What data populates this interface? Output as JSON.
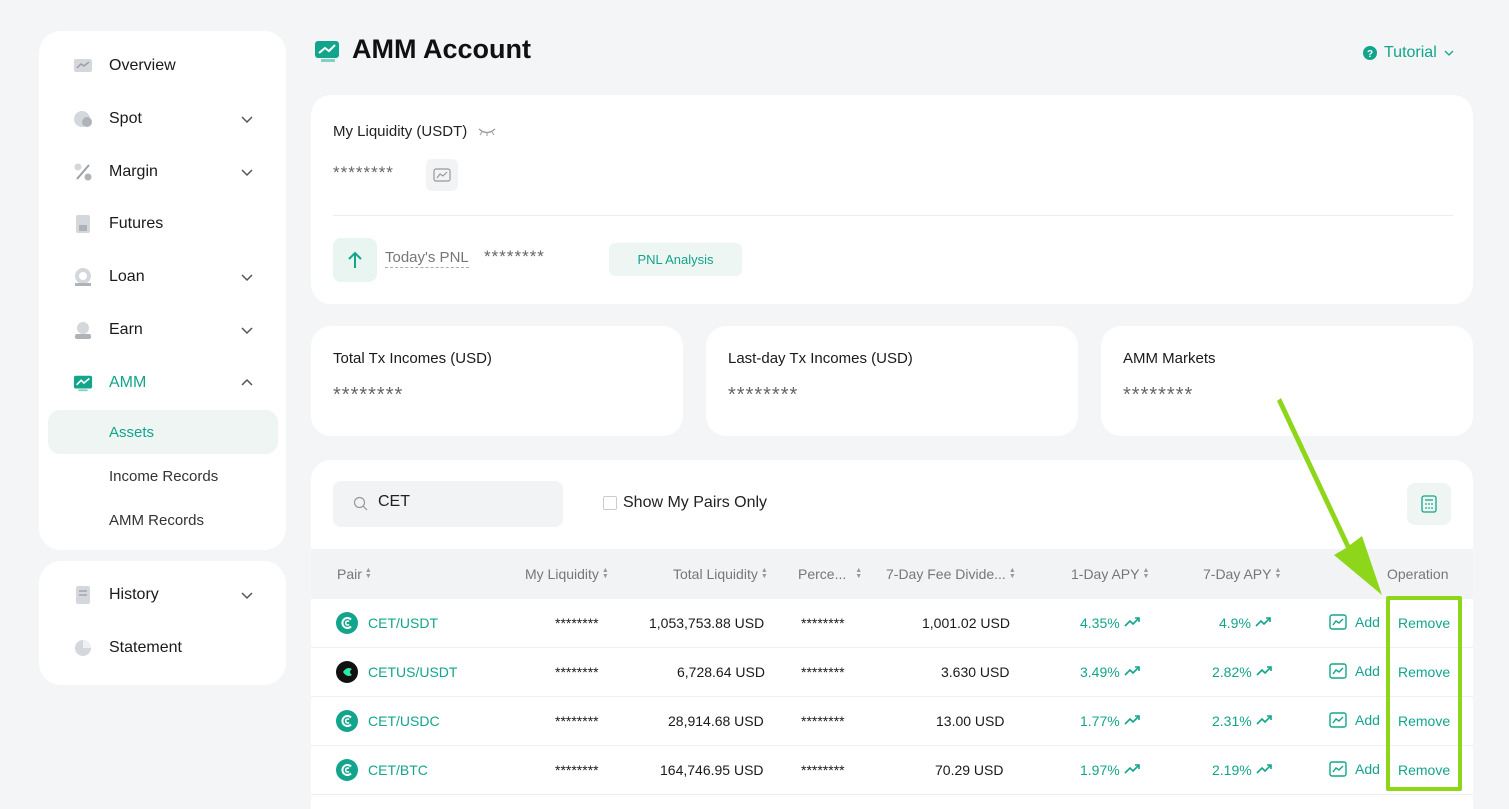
{
  "sidebar": {
    "items": [
      {
        "label": "Overview",
        "icon": "overview-icon"
      },
      {
        "label": "Spot",
        "icon": "spot-icon"
      },
      {
        "label": "Margin",
        "icon": "margin-icon"
      },
      {
        "label": "Futures",
        "icon": "futures-icon"
      },
      {
        "label": "Loan",
        "icon": "loan-icon"
      },
      {
        "label": "Earn",
        "icon": "earn-icon"
      },
      {
        "label": "AMM",
        "icon": "amm-icon"
      }
    ],
    "amm_sub": [
      {
        "label": "Assets"
      },
      {
        "label": "Income Records"
      },
      {
        "label": "AMM Records"
      }
    ],
    "bottom_items": [
      {
        "label": "History"
      },
      {
        "label": "Statement"
      }
    ]
  },
  "header": {
    "title": "AMM Account",
    "tutorial": "Tutorial"
  },
  "liquidity": {
    "title": "My Liquidity (USDT)",
    "value": "********",
    "pnl_label": "Today's PNL",
    "pnl_value": "********",
    "pnl_button": "PNL Analysis"
  },
  "stats": [
    {
      "label": "Total Tx Incomes (USD)",
      "value": "********"
    },
    {
      "label": "Last-day Tx Incomes (USD)",
      "value": "********"
    },
    {
      "label": "AMM Markets",
      "value": "********"
    }
  ],
  "table": {
    "search_value": "CET",
    "show_my_pairs": "Show My Pairs Only",
    "headers": {
      "pair": "Pair",
      "my_liquidity": "My Liquidity",
      "total_liquidity": "Total Liquidity",
      "percent": "Perce...",
      "fee": "7-Day Fee Divide...",
      "apy1": "1-Day APY",
      "apy7": "7-Day APY",
      "operation": "Operation"
    },
    "rows": [
      {
        "pair": "CET/USDT",
        "my_liq": "********",
        "total_liq": "1,053,753.88 USD",
        "percent": "********",
        "fee": "1,001.02 USD",
        "apy1": "4.35%",
        "apy7": "4.9%",
        "add": "Add",
        "remove": "Remove"
      },
      {
        "pair": "CETUS/USDT",
        "my_liq": "********",
        "total_liq": "6,728.64 USD",
        "percent": "********",
        "fee": "3.630 USD",
        "apy1": "3.49%",
        "apy7": "2.82%",
        "add": "Add",
        "remove": "Remove"
      },
      {
        "pair": "CET/USDC",
        "my_liq": "********",
        "total_liq": "28,914.68 USD",
        "percent": "********",
        "fee": "13.00 USD",
        "apy1": "1.77%",
        "apy7": "2.31%",
        "add": "Add",
        "remove": "Remove"
      },
      {
        "pair": "CET/BTC",
        "my_liq": "********",
        "total_liq": "164,746.95 USD",
        "percent": "********",
        "fee": "70.29 USD",
        "apy1": "1.97%",
        "apy7": "2.19%",
        "add": "Add",
        "remove": "Remove"
      }
    ]
  },
  "colors": {
    "accent": "#12a58c",
    "highlight": "#8ed61a"
  }
}
